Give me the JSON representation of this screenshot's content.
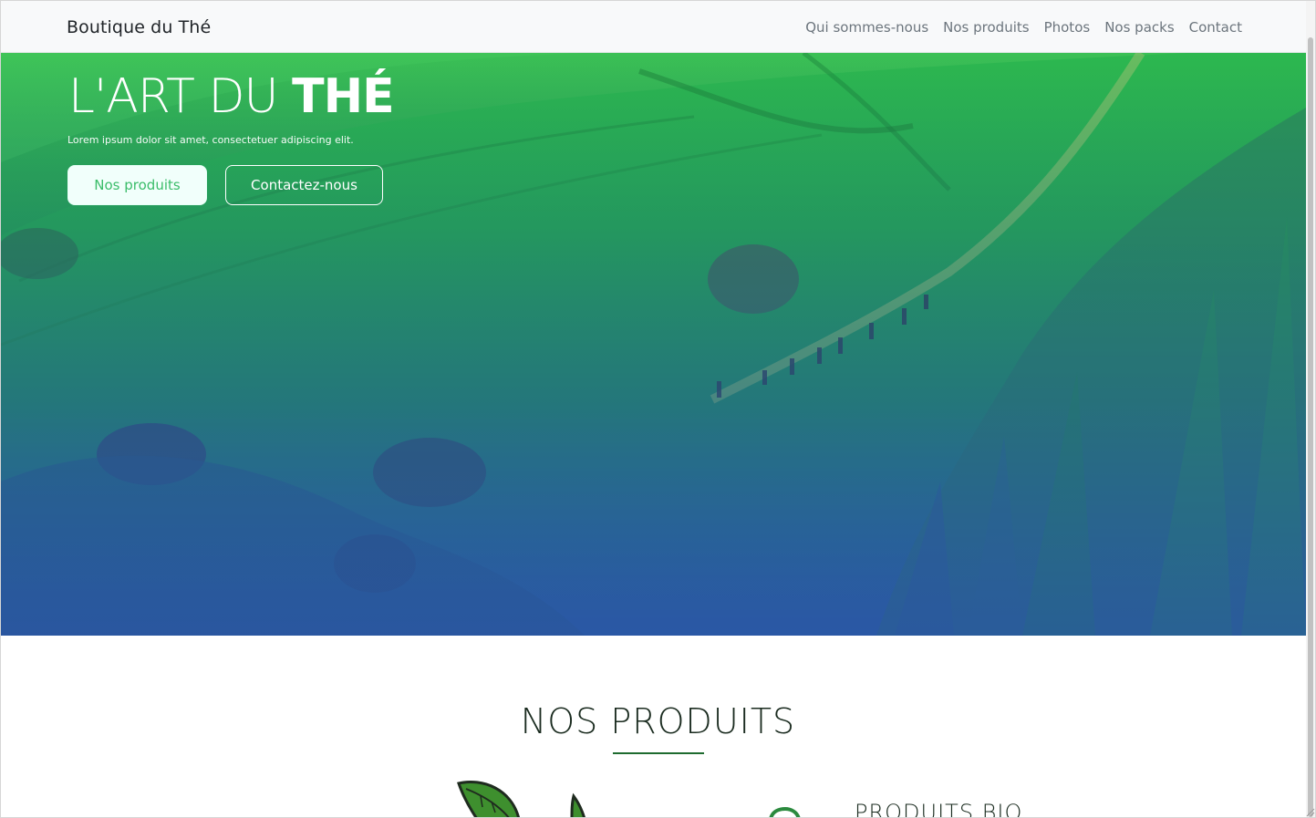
{
  "navbar": {
    "brand": "Boutique du Thé",
    "links": [
      "Qui sommes-nous",
      "Nos produits",
      "Photos",
      "Nos packs",
      "Contact"
    ]
  },
  "hero": {
    "title_light": "L'ART DU",
    "title_bold": "THÉ",
    "subtitle": "Lorem ipsum dolor sit amet, consectetuer adipiscing elit.",
    "primary_button": "Nos produits",
    "secondary_button": "Contactez-nous"
  },
  "products": {
    "title": "NOS PRODUITS",
    "feature_title": "PRODUITS BIO"
  },
  "colors": {
    "accent_green": "#1e6b2f",
    "button_text_green": "#3bbd6a",
    "navbar_bg": "#f8f9fa"
  }
}
